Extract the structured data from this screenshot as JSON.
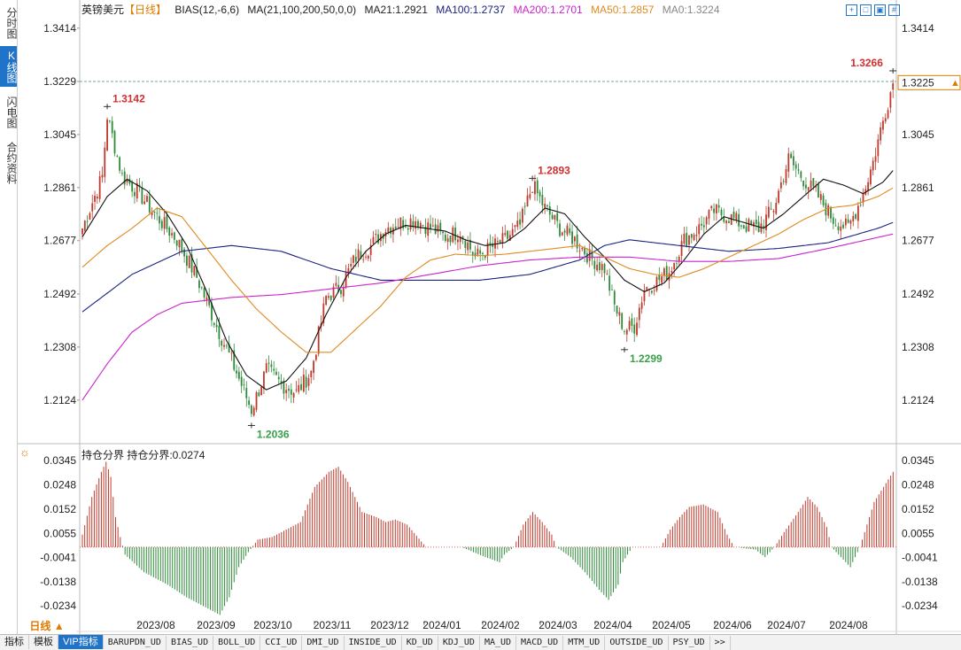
{
  "sidebar": {
    "tabs": [
      {
        "label": "分时图",
        "active": false
      },
      {
        "label": "K线图",
        "active": true
      },
      {
        "label": "闪电图",
        "active": false
      },
      {
        "label": "合约资料",
        "active": false
      }
    ]
  },
  "legend": {
    "symbol": "英镑美元",
    "period": "【日线】",
    "bias": "BIAS(12,-6,6)",
    "ma_params": "MA(21,100,200,50,0,0)",
    "ma21": "MA21:1.2921",
    "ma100": "MA100:1.2737",
    "ma200": "MA200:1.2701",
    "ma50": "MA50:1.2857",
    "ma0": "MA0:1.3224"
  },
  "colors": {
    "up": "#c0392b",
    "down": "#2e8b3a",
    "ma21": "#111111",
    "ma100": "#1a237e",
    "ma200": "#cc22cc",
    "ma50": "#e08a1e",
    "accent": "#1f73c9",
    "price_box": "#e07b00"
  },
  "sub_legend": {
    "text": "持仓分界  持仓分界:0.0274"
  },
  "period_button": "日线 ▲",
  "bottom_tabs": [
    {
      "label": "指标",
      "active": false,
      "mono": false
    },
    {
      "label": "模板",
      "active": false,
      "mono": false
    },
    {
      "label": "VIP指标",
      "active": true,
      "mono": false
    },
    {
      "label": "BARUPDN_UD",
      "active": false,
      "mono": true
    },
    {
      "label": "BIAS_UD",
      "active": false,
      "mono": true
    },
    {
      "label": "BOLL_UD",
      "active": false,
      "mono": true
    },
    {
      "label": "CCI_UD",
      "active": false,
      "mono": true
    },
    {
      "label": "DMI_UD",
      "active": false,
      "mono": true
    },
    {
      "label": "INSIDE_UD",
      "active": false,
      "mono": true
    },
    {
      "label": "KD_UD",
      "active": false,
      "mono": true
    },
    {
      "label": "KDJ_UD",
      "active": false,
      "mono": true
    },
    {
      "label": "MA_UD",
      "active": false,
      "mono": true
    },
    {
      "label": "MACD_UD",
      "active": false,
      "mono": true
    },
    {
      "label": "MTM_UD",
      "active": false,
      "mono": true
    },
    {
      "label": "OUTSIDE_UD",
      "active": false,
      "mono": true
    },
    {
      "label": "PSY_UD",
      "active": false,
      "mono": true
    },
    {
      "label": ">>",
      "active": false,
      "mono": true
    }
  ],
  "chart_data": [
    {
      "type": "candlestick",
      "title": "英镑美元",
      "y_ticks": [
        "1.3414",
        "1.3229",
        "1.3045",
        "1.2861",
        "1.2677",
        "1.2492",
        "1.2308",
        "1.2124"
      ],
      "ylim": [
        1.1976,
        1.3444
      ],
      "x_ticks": [
        "2023/08",
        "2023/09",
        "2023/10",
        "2023/11",
        "2023/12",
        "2024/01",
        "2024/02",
        "2024/03",
        "2024/04",
        "2024/05",
        "2024/06",
        "2024/07",
        "2024/08"
      ],
      "current_price": "1.3225",
      "price_line_label": "1.3229",
      "annotations": [
        {
          "label": "1.3142",
          "value": 1.3142,
          "kind": "high"
        },
        {
          "label": "1.2036",
          "value": 1.2036,
          "kind": "low"
        },
        {
          "label": "1.2893",
          "value": 1.2893,
          "kind": "high"
        },
        {
          "label": "1.2299",
          "value": 1.2299,
          "kind": "low"
        },
        {
          "label": "1.3266",
          "value": 1.3266,
          "kind": "high"
        }
      ],
      "close_anchors": [
        [
          0,
          1.272
        ],
        [
          8,
          1.29
        ],
        [
          10,
          1.311
        ],
        [
          16,
          1.29
        ],
        [
          22,
          1.285
        ],
        [
          30,
          1.276
        ],
        [
          38,
          1.268
        ],
        [
          46,
          1.255
        ],
        [
          54,
          1.238
        ],
        [
          62,
          1.222
        ],
        [
          68,
          1.209
        ],
        [
          74,
          1.223
        ],
        [
          80,
          1.218
        ],
        [
          86,
          1.215
        ],
        [
          92,
          1.222
        ],
        [
          98,
          1.248
        ],
        [
          104,
          1.252
        ],
        [
          110,
          1.262
        ],
        [
          116,
          1.266
        ],
        [
          122,
          1.272
        ],
        [
          128,
          1.274
        ],
        [
          134,
          1.275
        ],
        [
          140,
          1.272
        ],
        [
          146,
          1.269
        ],
        [
          152,
          1.271
        ],
        [
          158,
          1.262
        ],
        [
          164,
          1.265
        ],
        [
          170,
          1.268
        ],
        [
          176,
          1.273
        ],
        [
          181,
          1.287
        ],
        [
          186,
          1.279
        ],
        [
          192,
          1.272
        ],
        [
          198,
          1.268
        ],
        [
          204,
          1.262
        ],
        [
          210,
          1.258
        ],
        [
          214,
          1.245
        ],
        [
          218,
          1.237
        ],
        [
          222,
          1.238
        ],
        [
          226,
          1.251
        ],
        [
          230,
          1.253
        ],
        [
          236,
          1.257
        ],
        [
          242,
          1.268
        ],
        [
          248,
          1.272
        ],
        [
          254,
          1.278
        ],
        [
          260,
          1.276
        ],
        [
          266,
          1.273
        ],
        [
          272,
          1.272
        ],
        [
          278,
          1.279
        ],
        [
          284,
          1.296
        ],
        [
          290,
          1.289
        ],
        [
          296,
          1.283
        ],
        [
          302,
          1.275
        ],
        [
          308,
          1.272
        ],
        [
          314,
          1.284
        ],
        [
          318,
          1.295
        ],
        [
          321,
          1.306
        ],
        [
          324,
          1.316
        ],
        [
          326,
          1.3225
        ]
      ],
      "series": [
        {
          "name": "MA21",
          "anchors": [
            [
              0,
              1.269
            ],
            [
              10,
              1.283
            ],
            [
              18,
              1.289
            ],
            [
              26,
              1.285
            ],
            [
              34,
              1.277
            ],
            [
              42,
              1.266
            ],
            [
              50,
              1.25
            ],
            [
              58,
              1.233
            ],
            [
              66,
              1.221
            ],
            [
              74,
              1.216
            ],
            [
              82,
              1.219
            ],
            [
              90,
              1.227
            ],
            [
              98,
              1.242
            ],
            [
              106,
              1.255
            ],
            [
              114,
              1.264
            ],
            [
              122,
              1.27
            ],
            [
              130,
              1.273
            ],
            [
              138,
              1.272
            ],
            [
              146,
              1.271
            ],
            [
              154,
              1.268
            ],
            [
              162,
              1.266
            ],
            [
              170,
              1.267
            ],
            [
              178,
              1.272
            ],
            [
              186,
              1.279
            ],
            [
              194,
              1.277
            ],
            [
              202,
              1.269
            ],
            [
              210,
              1.262
            ],
            [
              218,
              1.254
            ],
            [
              226,
              1.25
            ],
            [
              234,
              1.253
            ],
            [
              242,
              1.261
            ],
            [
              250,
              1.27
            ],
            [
              258,
              1.276
            ],
            [
              266,
              1.274
            ],
            [
              274,
              1.272
            ],
            [
              282,
              1.277
            ],
            [
              290,
              1.283
            ],
            [
              298,
              1.289
            ],
            [
              306,
              1.287
            ],
            [
              314,
              1.284
            ],
            [
              322,
              1.288
            ],
            [
              326,
              1.292
            ]
          ]
        },
        {
          "name": "MA100",
          "anchors": [
            [
              0,
              1.243
            ],
            [
              20,
              1.256
            ],
            [
              40,
              1.264
            ],
            [
              60,
              1.266
            ],
            [
              80,
              1.264
            ],
            [
              100,
              1.258
            ],
            [
              120,
              1.254
            ],
            [
              140,
              1.254
            ],
            [
              160,
              1.254
            ],
            [
              180,
              1.256
            ],
            [
              200,
              1.261
            ],
            [
              210,
              1.266
            ],
            [
              220,
              1.268
            ],
            [
              240,
              1.266
            ],
            [
              260,
              1.264
            ],
            [
              280,
              1.265
            ],
            [
              300,
              1.267
            ],
            [
              320,
              1.272
            ],
            [
              326,
              1.274
            ]
          ]
        },
        {
          "name": "MA200",
          "anchors": [
            [
              0,
              1.2124
            ],
            [
              10,
              1.225
            ],
            [
              20,
              1.236
            ],
            [
              30,
              1.242
            ],
            [
              40,
              1.246
            ],
            [
              60,
              1.248
            ],
            [
              80,
              1.249
            ],
            [
              100,
              1.251
            ],
            [
              120,
              1.253
            ],
            [
              140,
              1.256
            ],
            [
              160,
              1.259
            ],
            [
              180,
              1.261
            ],
            [
              200,
              1.262
            ],
            [
              220,
              1.262
            ],
            [
              240,
              1.2605
            ],
            [
              260,
              1.2605
            ],
            [
              280,
              1.2615
            ],
            [
              300,
              1.265
            ],
            [
              326,
              1.27
            ]
          ]
        },
        {
          "name": "MA50",
          "anchors": [
            [
              0,
              1.2585
            ],
            [
              10,
              1.266
            ],
            [
              20,
              1.272
            ],
            [
              30,
              1.279
            ],
            [
              40,
              1.276
            ],
            [
              50,
              1.265
            ],
            [
              60,
              1.254
            ],
            [
              70,
              1.244
            ],
            [
              80,
              1.236
            ],
            [
              90,
              1.229
            ],
            [
              100,
              1.229
            ],
            [
              110,
              1.237
            ],
            [
              120,
              1.245
            ],
            [
              130,
              1.255
            ],
            [
              140,
              1.261
            ],
            [
              150,
              1.263
            ],
            [
              160,
              1.2625
            ],
            [
              170,
              1.263
            ],
            [
              180,
              1.264
            ],
            [
              190,
              1.265
            ],
            [
              200,
              1.266
            ],
            [
              210,
              1.262
            ],
            [
              220,
              1.258
            ],
            [
              230,
              1.256
            ],
            [
              240,
              1.255
            ],
            [
              250,
              1.258
            ],
            [
              260,
              1.262
            ],
            [
              270,
              1.266
            ],
            [
              280,
              1.27
            ],
            [
              290,
              1.275
            ],
            [
              300,
              1.279
            ],
            [
              310,
              1.28
            ],
            [
              320,
              1.283
            ],
            [
              326,
              1.286
            ]
          ]
        }
      ]
    },
    {
      "type": "bar",
      "title": "持仓分界",
      "current_value": "0.0274",
      "y_ticks": [
        "0.0345",
        "0.0248",
        "0.0152",
        "0.0055",
        "-0.0041",
        "-0.0138",
        "-0.0234"
      ],
      "ylim": [
        -0.029,
        0.037
      ],
      "anchors": [
        [
          0,
          0.005
        ],
        [
          4,
          0.02
        ],
        [
          8,
          0.03
        ],
        [
          10,
          0.034
        ],
        [
          12,
          0.028
        ],
        [
          14,
          0.012
        ],
        [
          16,
          0.004
        ],
        [
          18,
          -0.003
        ],
        [
          26,
          -0.01
        ],
        [
          36,
          -0.015
        ],
        [
          44,
          -0.02
        ],
        [
          52,
          -0.024
        ],
        [
          58,
          -0.027
        ],
        [
          62,
          -0.02
        ],
        [
          66,
          -0.008
        ],
        [
          70,
          -0.002
        ],
        [
          74,
          0.003
        ],
        [
          80,
          0.004
        ],
        [
          86,
          0.007
        ],
        [
          92,
          0.01
        ],
        [
          98,
          0.024
        ],
        [
          104,
          0.03
        ],
        [
          108,
          0.032
        ],
        [
          112,
          0.026
        ],
        [
          118,
          0.014
        ],
        [
          124,
          0.012
        ],
        [
          128,
          0.01
        ],
        [
          132,
          0.011
        ],
        [
          137,
          0.009
        ],
        [
          145,
          0
        ],
        [
          160,
          0
        ],
        [
          170,
          -0.004
        ],
        [
          176,
          -0.006
        ],
        [
          178,
          -0.003
        ],
        [
          182,
          0
        ],
        [
          186,
          0.009
        ],
        [
          190,
          0.014
        ],
        [
          194,
          0.01
        ],
        [
          198,
          0.005
        ],
        [
          200,
          0
        ],
        [
          206,
          -0.004
        ],
        [
          212,
          -0.01
        ],
        [
          218,
          -0.017
        ],
        [
          222,
          -0.021
        ],
        [
          226,
          -0.015
        ],
        [
          228,
          -0.006
        ],
        [
          232,
          0
        ],
        [
          244,
          0
        ],
        [
          248,
          0.007
        ],
        [
          252,
          0.012
        ],
        [
          256,
          0.016
        ],
        [
          262,
          0.017
        ],
        [
          268,
          0.014
        ],
        [
          272,
          0.005
        ],
        [
          275,
          0
        ],
        [
          284,
          -0.001
        ],
        [
          288,
          -0.004
        ],
        [
          292,
          0
        ],
        [
          296,
          0.006
        ],
        [
          302,
          0.014
        ],
        [
          306,
          0.02
        ],
        [
          310,
          0.016
        ],
        [
          314,
          0.008
        ],
        [
          316,
          0
        ],
        [
          322,
          -0.006
        ],
        [
          324,
          -0.008
        ],
        [
          326,
          -0.004
        ],
        [
          328,
          0
        ],
        [
          330,
          0.006
        ],
        [
          334,
          0.018
        ],
        [
          340,
          0.027
        ],
        [
          342,
          0.03
        ]
      ]
    }
  ]
}
